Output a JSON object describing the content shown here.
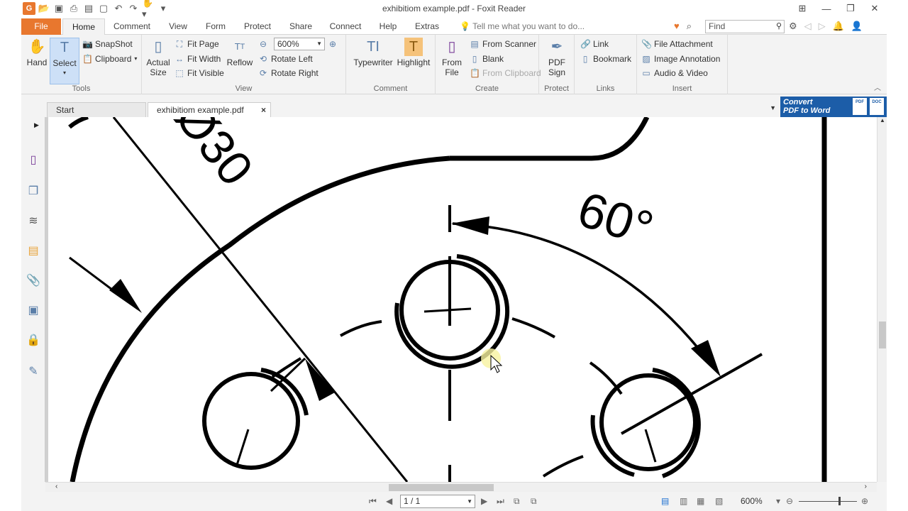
{
  "window": {
    "title": "exhibitiom example.pdf - Foxit Reader"
  },
  "menu": {
    "file": "File",
    "tabs": [
      "Home",
      "Comment",
      "View",
      "Form",
      "Protect",
      "Share",
      "Connect",
      "Help",
      "Extras"
    ],
    "tell_me": "Tell me what you want to do...",
    "find_placeholder": "Find"
  },
  "ribbon": {
    "tools": {
      "label": "Tools",
      "hand": "Hand",
      "select": "Select",
      "snapshot": "SnapShot",
      "clipboard": "Clipboard"
    },
    "view": {
      "label": "View",
      "actual_size_1": "Actual",
      "actual_size_2": "Size",
      "fit_page": "Fit Page",
      "fit_width": "Fit Width",
      "fit_visible": "Fit Visible",
      "reflow": "Reflow",
      "zoom_value": "600%",
      "rotate_left": "Rotate Left",
      "rotate_right": "Rotate Right"
    },
    "comment": {
      "label": "Comment",
      "typewriter": "Typewriter",
      "highlight": "Highlight"
    },
    "create": {
      "label": "Create",
      "from_file_1": "From",
      "from_file_2": "File",
      "from_scanner": "From Scanner",
      "blank": "Blank",
      "from_clipboard": "From Clipboard"
    },
    "protect": {
      "label": "Protect",
      "pdf_sign_1": "PDF",
      "pdf_sign_2": "Sign"
    },
    "links": {
      "label": "Links",
      "link": "Link",
      "bookmark": "Bookmark"
    },
    "insert": {
      "label": "Insert",
      "file_attachment": "File Attachment",
      "image_annotation": "Image Annotation",
      "audio_video": "Audio & Video"
    }
  },
  "doc_tabs": {
    "start": "Start",
    "current": "exhibitiom example.pdf",
    "close": "×"
  },
  "promo": {
    "line1": "Convert",
    "line2": "PDF to Word"
  },
  "drawing": {
    "dim_diameter": "Ø30",
    "dim_angle": "60°"
  },
  "status": {
    "page": "1 / 1",
    "zoom": "600%"
  }
}
